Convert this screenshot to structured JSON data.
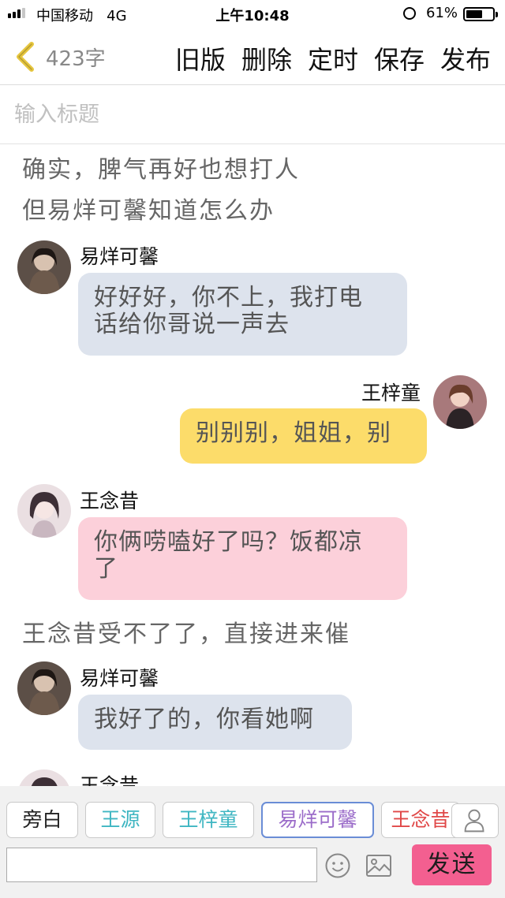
{
  "status_bar": {
    "carrier": "中国移动",
    "network": "4G",
    "time": "上午10:48",
    "battery_percent": "61%",
    "battery_level": 0.61,
    "icons": [
      "signal-icon",
      "alarm-icon",
      "battery-icon"
    ]
  },
  "nav": {
    "back_icon": "chevron-left-icon",
    "word_count": "423字",
    "actions": {
      "old_version": "旧版",
      "delete": "删除",
      "schedule": "定时",
      "save": "保存",
      "publish": "发布"
    }
  },
  "title_input": {
    "placeholder": "输入标题",
    "value": ""
  },
  "chat": {
    "narration_1": "确实，脾气再好也想打人",
    "narration_2": "但易烊可馨知道怎么办",
    "msg1": {
      "sender": "易烊可馨",
      "text_line1": "好好好，你不上，我打电",
      "text_line2": "话给你哥说一声去",
      "side": "left",
      "bubble_color": "#dde3ed"
    },
    "msg2": {
      "sender": "王梓童",
      "text": "别别别，姐姐，别",
      "side": "right",
      "bubble_color": "#fcdc6a"
    },
    "msg3": {
      "sender": "王念昔",
      "text_line1": "你俩唠嗑好了吗？饭都凉",
      "text_line2": "了",
      "side": "left",
      "bubble_color": "#fcd0da"
    },
    "narration_3": "王念昔受不了了，直接进来催",
    "msg4": {
      "sender": "易烊可馨",
      "text": "我好了的，你看她啊",
      "side": "left",
      "bubble_color": "#dde3ed"
    },
    "msg5": {
      "sender": "王念昔"
    }
  },
  "roles": [
    {
      "label": "旁白",
      "color": "#222222"
    },
    {
      "label": "王源",
      "color": "#3fb6c2"
    },
    {
      "label": "王梓童",
      "color": "#3fb6c2"
    },
    {
      "label": "易烊可馨",
      "color": "#9b6cc9"
    },
    {
      "label": "王念昔",
      "color": "#e04848"
    }
  ],
  "composer": {
    "placeholder": "",
    "send_label": "发送",
    "icons": [
      "user-icon",
      "emoji-icon",
      "image-icon"
    ],
    "send_color": "#f35f90"
  }
}
